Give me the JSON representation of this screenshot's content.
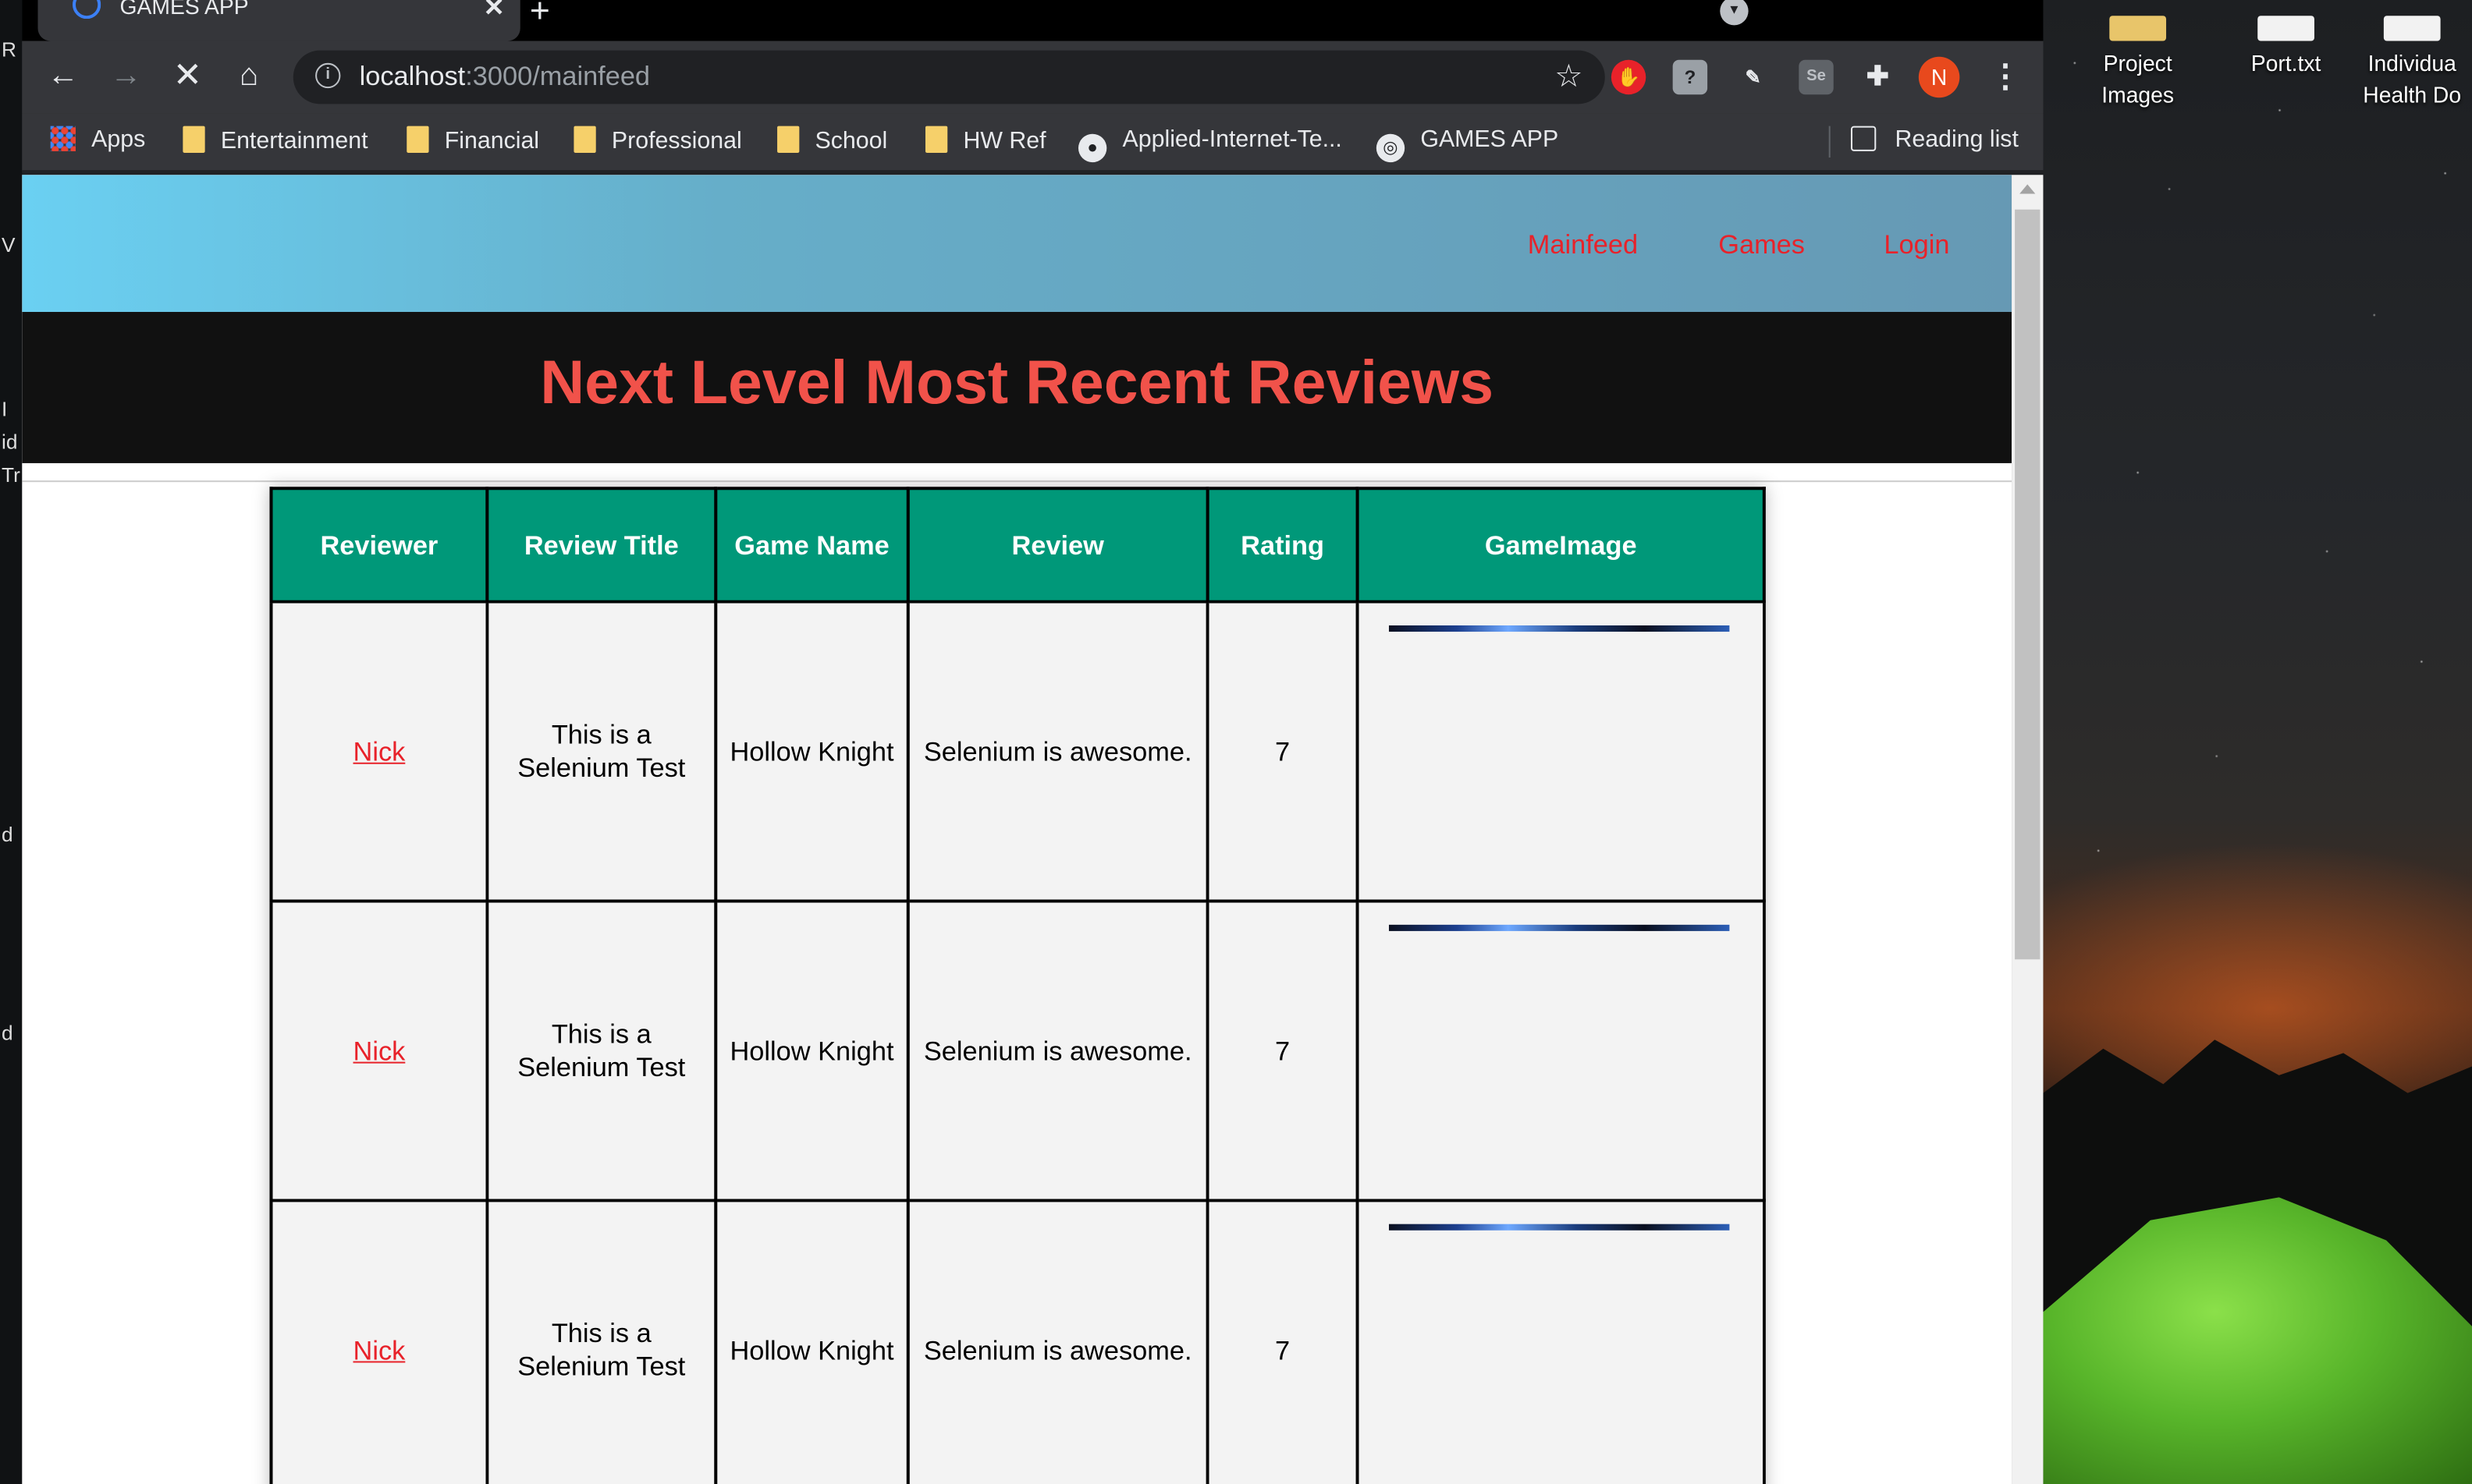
{
  "browser": {
    "tab_title": "GAMES APP",
    "url_host": "localhost",
    "url_path": ":3000/mainfeed",
    "profile_initial": "N",
    "bookmarks": [
      {
        "label": "Apps",
        "icon": "apps-grid-icon"
      },
      {
        "label": "Entertainment",
        "icon": "folder-icon"
      },
      {
        "label": "Financial",
        "icon": "folder-icon"
      },
      {
        "label": "Professional",
        "icon": "folder-icon"
      },
      {
        "label": "School",
        "icon": "folder-icon"
      },
      {
        "label": "HW Ref",
        "icon": "folder-icon"
      },
      {
        "label": "Applied-Internet-Te...",
        "icon": "github-icon"
      },
      {
        "label": "GAMES APP",
        "icon": "globe-icon"
      }
    ],
    "reading_list": "Reading list",
    "colors": {
      "chrome_dark": "#35363a",
      "tab_strip": "#000000",
      "profile": "#e8491d"
    }
  },
  "site": {
    "nav": {
      "mainfeed": "Mainfeed",
      "games": "Games",
      "login": "Login"
    },
    "heading": "Next Level Most Recent Reviews",
    "colors": {
      "nav_link": "#e8222a",
      "heading": "#f1524a",
      "table_header": "#009879"
    },
    "table": {
      "headers": [
        "Reviewer",
        "Review Title",
        "Game Name",
        "Review",
        "Rating",
        "GameImage"
      ],
      "rows": [
        {
          "reviewer": "Nick",
          "title": "This is a Selenium Test",
          "game": "Hollow Knight",
          "review": "Selenium is awesome.",
          "rating": "7"
        },
        {
          "reviewer": "Nick",
          "title": "This is a Selenium Test",
          "game": "Hollow Knight",
          "review": "Selenium is awesome.",
          "rating": "7"
        },
        {
          "reviewer": "Nick",
          "title": "This is a Selenium Test",
          "game": "Hollow Knight",
          "review": "Selenium is awesome.",
          "rating": "7"
        }
      ]
    }
  },
  "desktop": {
    "icons": [
      {
        "label": "Project Images"
      },
      {
        "label": "Port.txt"
      },
      {
        "label": "Individua Health Do"
      }
    ],
    "left_edge_chars": [
      "R",
      "V",
      "I",
      "id",
      "Tr",
      "d",
      "d"
    ]
  }
}
